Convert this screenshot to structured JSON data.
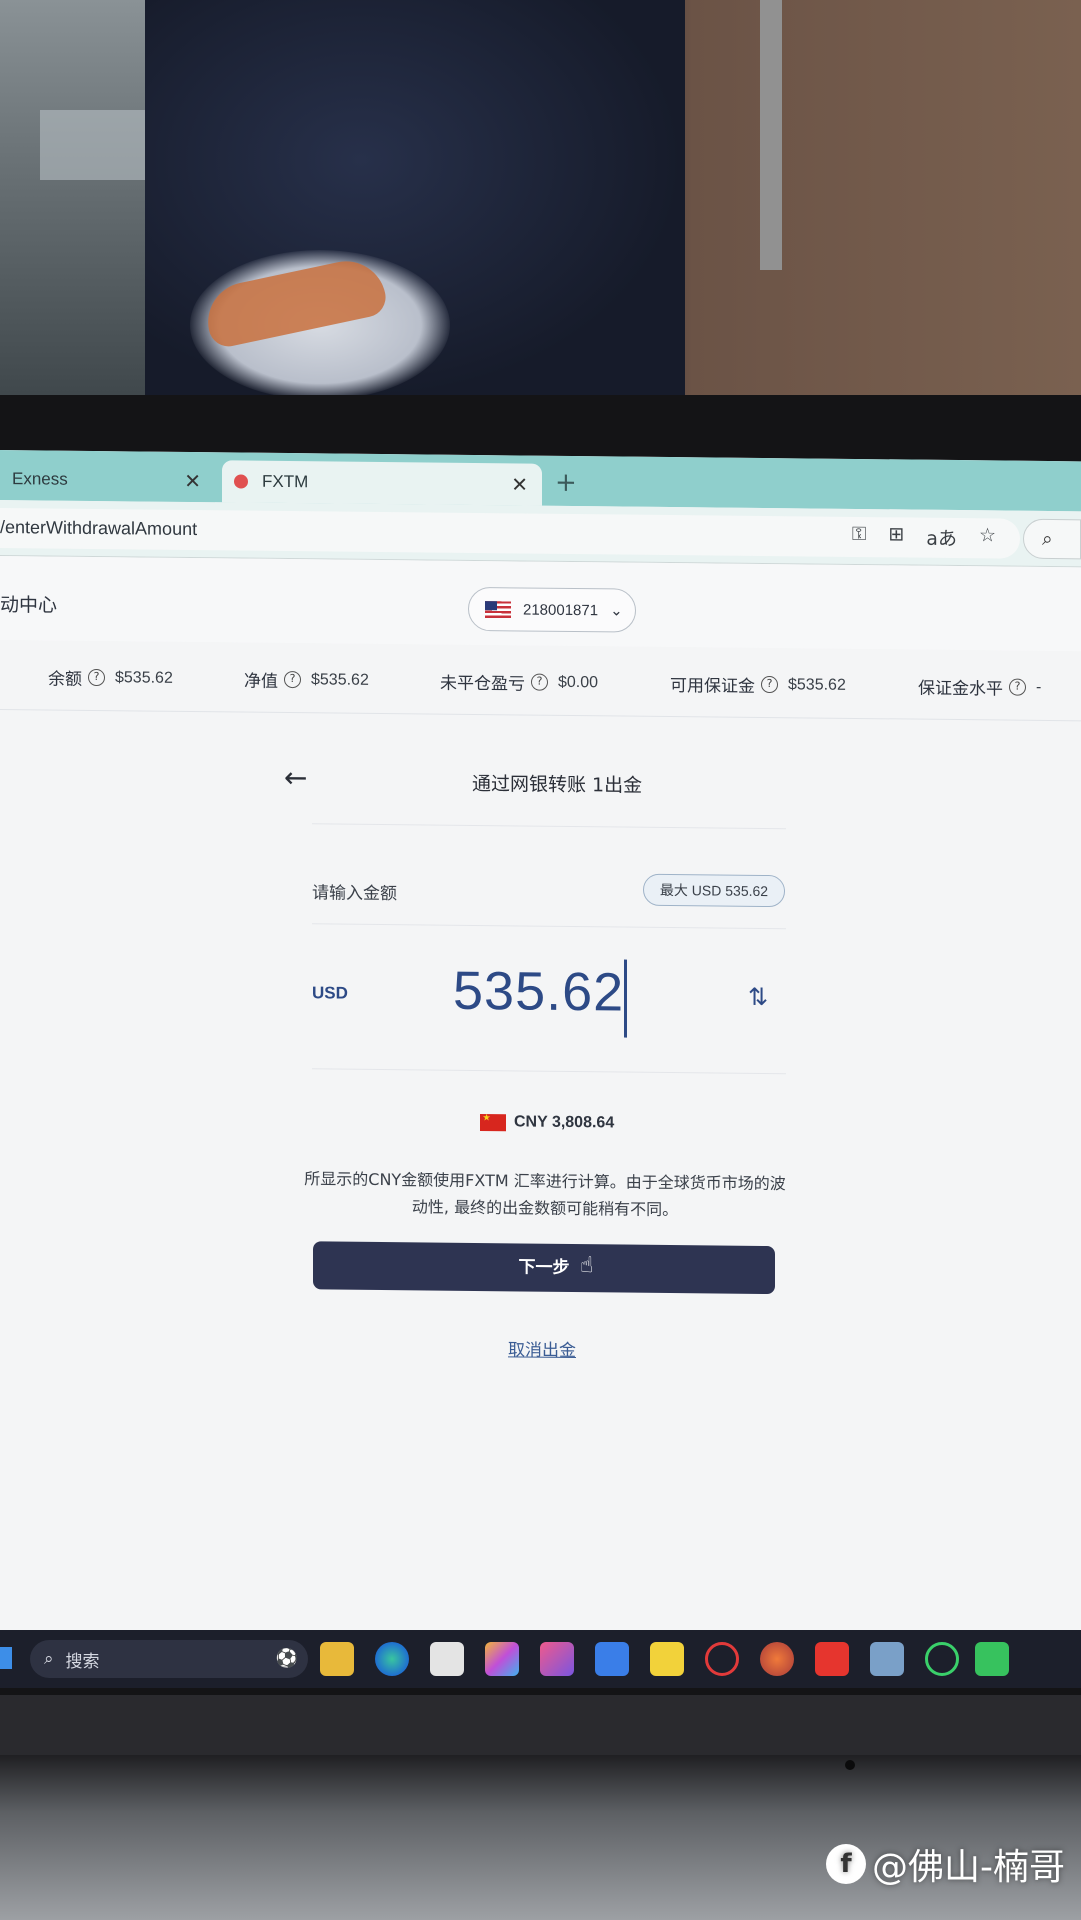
{
  "browser": {
    "tabs": [
      {
        "label": "Exness",
        "active": false
      },
      {
        "label": "FXTM",
        "active": true
      }
    ],
    "address": "/enterWithdrawalAmount"
  },
  "header": {
    "activity_label": "活动中心",
    "activity_visible": "动中心",
    "account_number": "218001871"
  },
  "stats": [
    {
      "label": "余额",
      "value": "$535.62"
    },
    {
      "label": "净值",
      "value": "$535.62"
    },
    {
      "label": "未平仓盈亏",
      "value": "$0.00"
    },
    {
      "label": "可用保证金",
      "value": "$535.62"
    },
    {
      "label": "保证金水平",
      "value": "-"
    }
  ],
  "withdrawal": {
    "title": "通过网银转账 1出金",
    "enter_label": "请输入金额",
    "max_label": "最大 USD 535.62",
    "currency": "USD",
    "amount": "535.62",
    "converted": "CNY 3,808.64",
    "note": "所显示的CNY金额使用FXTM 汇率进行计算。由于全球货币市场的波动性, 最终的出金数额可能稍有不同。",
    "next_label": "下一步",
    "cancel_label": "取消出金"
  },
  "taskbar": {
    "search_placeholder": "搜索"
  },
  "watermark": {
    "text": "@佛山-楠哥"
  },
  "colors": {
    "accent_blue": "#2d4a86",
    "button_dark": "#2e3452",
    "tab_teal": "#8fcfcc"
  }
}
